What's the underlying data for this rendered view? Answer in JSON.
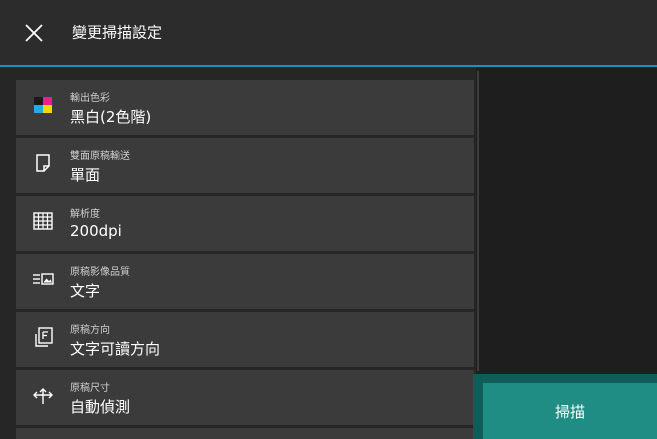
{
  "header": {
    "title": "變更掃描設定",
    "close_icon": "close-icon"
  },
  "settings": [
    {
      "label": "輸出色彩",
      "value": "黑白(2色階)",
      "icon": "color-output-icon"
    },
    {
      "label": "雙面原稿輸送",
      "value": "單面",
      "icon": "document-icon"
    },
    {
      "label": "解析度",
      "value": "200dpi",
      "icon": "grid-icon"
    },
    {
      "label": "原稿影像品質",
      "value": "文字",
      "icon": "image-quality-icon"
    },
    {
      "label": "原稿方向",
      "value": "文字可讀方向",
      "icon": "orientation-icon"
    },
    {
      "label": "原稿尺寸",
      "value": "自動偵測",
      "icon": "resize-arrows-icon"
    }
  ],
  "actions": {
    "scan_label": "掃描"
  },
  "colors": {
    "accent": "#1d8fc4",
    "scan_button": "#1f8d84"
  }
}
